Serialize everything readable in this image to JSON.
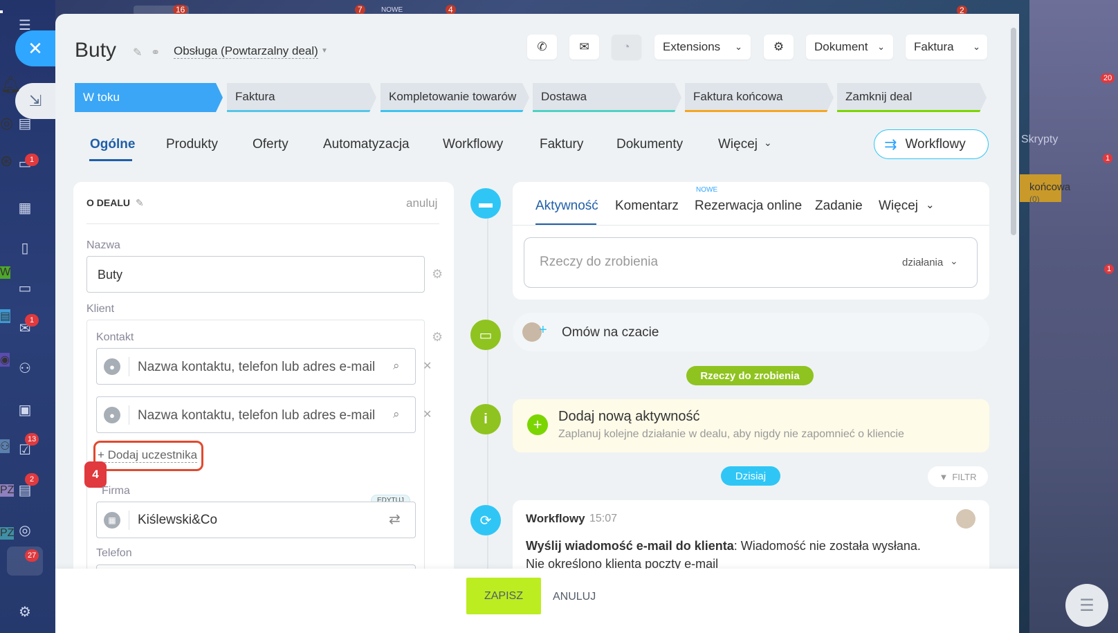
{
  "bg_notif": {
    "b1": "16",
    "b2": "7",
    "b3": "NOWE",
    "b4": "4",
    "b5": "2"
  },
  "left_sidebar": {
    "badges": [
      "1",
      "1",
      "13",
      "2",
      "27"
    ]
  },
  "right_sidebar": {
    "notif_count": "20",
    "chat_count": "1",
    "skrypty": "Skrypty",
    "koncowa": "końcowa",
    "koncowa_count": "(0)",
    "w_avatar": "W",
    "w_count": "1",
    "pz1": "PZ",
    "pz2": "PZ"
  },
  "header": {
    "title": "Buty",
    "category": "Obsługa (Powtarzalny deal)",
    "extensions": "Extensions",
    "dokument": "Dokument",
    "faktura": "Faktura"
  },
  "stages": [
    {
      "label": "W toku",
      "color": "#2fa6ff"
    },
    {
      "label": "Faktura",
      "color": "#55c5e8"
    },
    {
      "label": "Kompletowanie towarów",
      "color": "#3ec3ef"
    },
    {
      "label": "Dostawa",
      "color": "#4fd1c5"
    },
    {
      "label": "Faktura końcowa",
      "color": "#f5a623"
    },
    {
      "label": "Zamknij deal",
      "color": "#7bd500"
    }
  ],
  "tabs": [
    "Ogólne",
    "Produkty",
    "Oferty",
    "Automatyzacja",
    "Workflowy",
    "Faktury",
    "Dokumenty",
    "Więcej"
  ],
  "workflowy_button": "Workflowy",
  "deal_card": {
    "section_title": "O DEALU",
    "cancel": "anuluj",
    "name_label": "Nazwa",
    "name_value": "Buty",
    "client_label": "Klient",
    "contact_label": "Kontakt",
    "contact_placeholder": "Nazwa kontaktu, telefon lub adres e-mail",
    "add_participant": "+ Dodaj uczestnika",
    "step_badge": "4",
    "company_label": "Firma",
    "edit_badge": "EDYTUJ",
    "company_value": "Kiślewski&Co",
    "phone_label": "Telefon"
  },
  "activity": {
    "tabs": [
      "Aktywność",
      "Komentarz",
      "Rezerwacja online",
      "Zadanie",
      "Więcej"
    ],
    "new_badge": "NOWE",
    "todo_placeholder": "Rzeczy do zrobienia",
    "actions": "działania",
    "chat_text": "Omów na czacie",
    "todo_pill": "Rzeczy do zrobienia",
    "add_title": "Dodaj nową aktywność",
    "add_sub": "Zaplanuj kolejne działanie w dealu, aby nigdy nie zapomnieć o kliencie",
    "today_pill": "Dzisiaj",
    "filter": "FILTR",
    "wf_title": "Workflowy",
    "wf_time": "15:07",
    "wf_bold": "Wyślij wiadomość e-mail do klienta",
    "wf_rest": ": Wiadomość nie została wysłana.",
    "wf_line2": "Nie określono klienta poczty e-mail"
  },
  "footer": {
    "save": "ZAPISZ",
    "cancel": "ANULUJ"
  }
}
